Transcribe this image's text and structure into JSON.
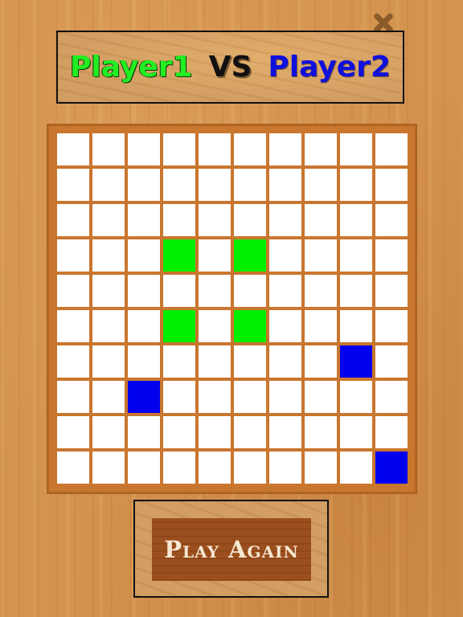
{
  "title": {
    "player1": "Player1",
    "vs": "VS",
    "player2": "Player2"
  },
  "colors": {
    "player1": "#00ee00",
    "player2": "#0000ee",
    "empty": "#ffffff",
    "board_frame": "#c9762e"
  },
  "board": {
    "rows": 10,
    "cols": 10,
    "cells": [
      [
        "",
        "",
        "",
        "",
        "",
        "",
        "",
        "",
        "",
        ""
      ],
      [
        "",
        "",
        "",
        "",
        "",
        "",
        "",
        "",
        "",
        ""
      ],
      [
        "",
        "",
        "",
        "",
        "",
        "",
        "",
        "",
        "",
        ""
      ],
      [
        "",
        "",
        "",
        "g",
        "",
        "g",
        "",
        "",
        "",
        ""
      ],
      [
        "",
        "",
        "",
        "",
        "",
        "",
        "",
        "",
        "",
        ""
      ],
      [
        "",
        "",
        "",
        "g",
        "",
        "g",
        "",
        "",
        "",
        ""
      ],
      [
        "",
        "",
        "",
        "",
        "",
        "",
        "",
        "",
        "b",
        ""
      ],
      [
        "",
        "",
        "b",
        "",
        "",
        "",
        "",
        "",
        "",
        ""
      ],
      [
        "",
        "",
        "",
        "",
        "",
        "",
        "",
        "",
        "",
        ""
      ],
      [
        "",
        "",
        "",
        "",
        "",
        "",
        "",
        "",
        "",
        "b"
      ]
    ]
  },
  "buttons": {
    "close_icon": "close-icon",
    "play_again_label": "Play Again"
  }
}
